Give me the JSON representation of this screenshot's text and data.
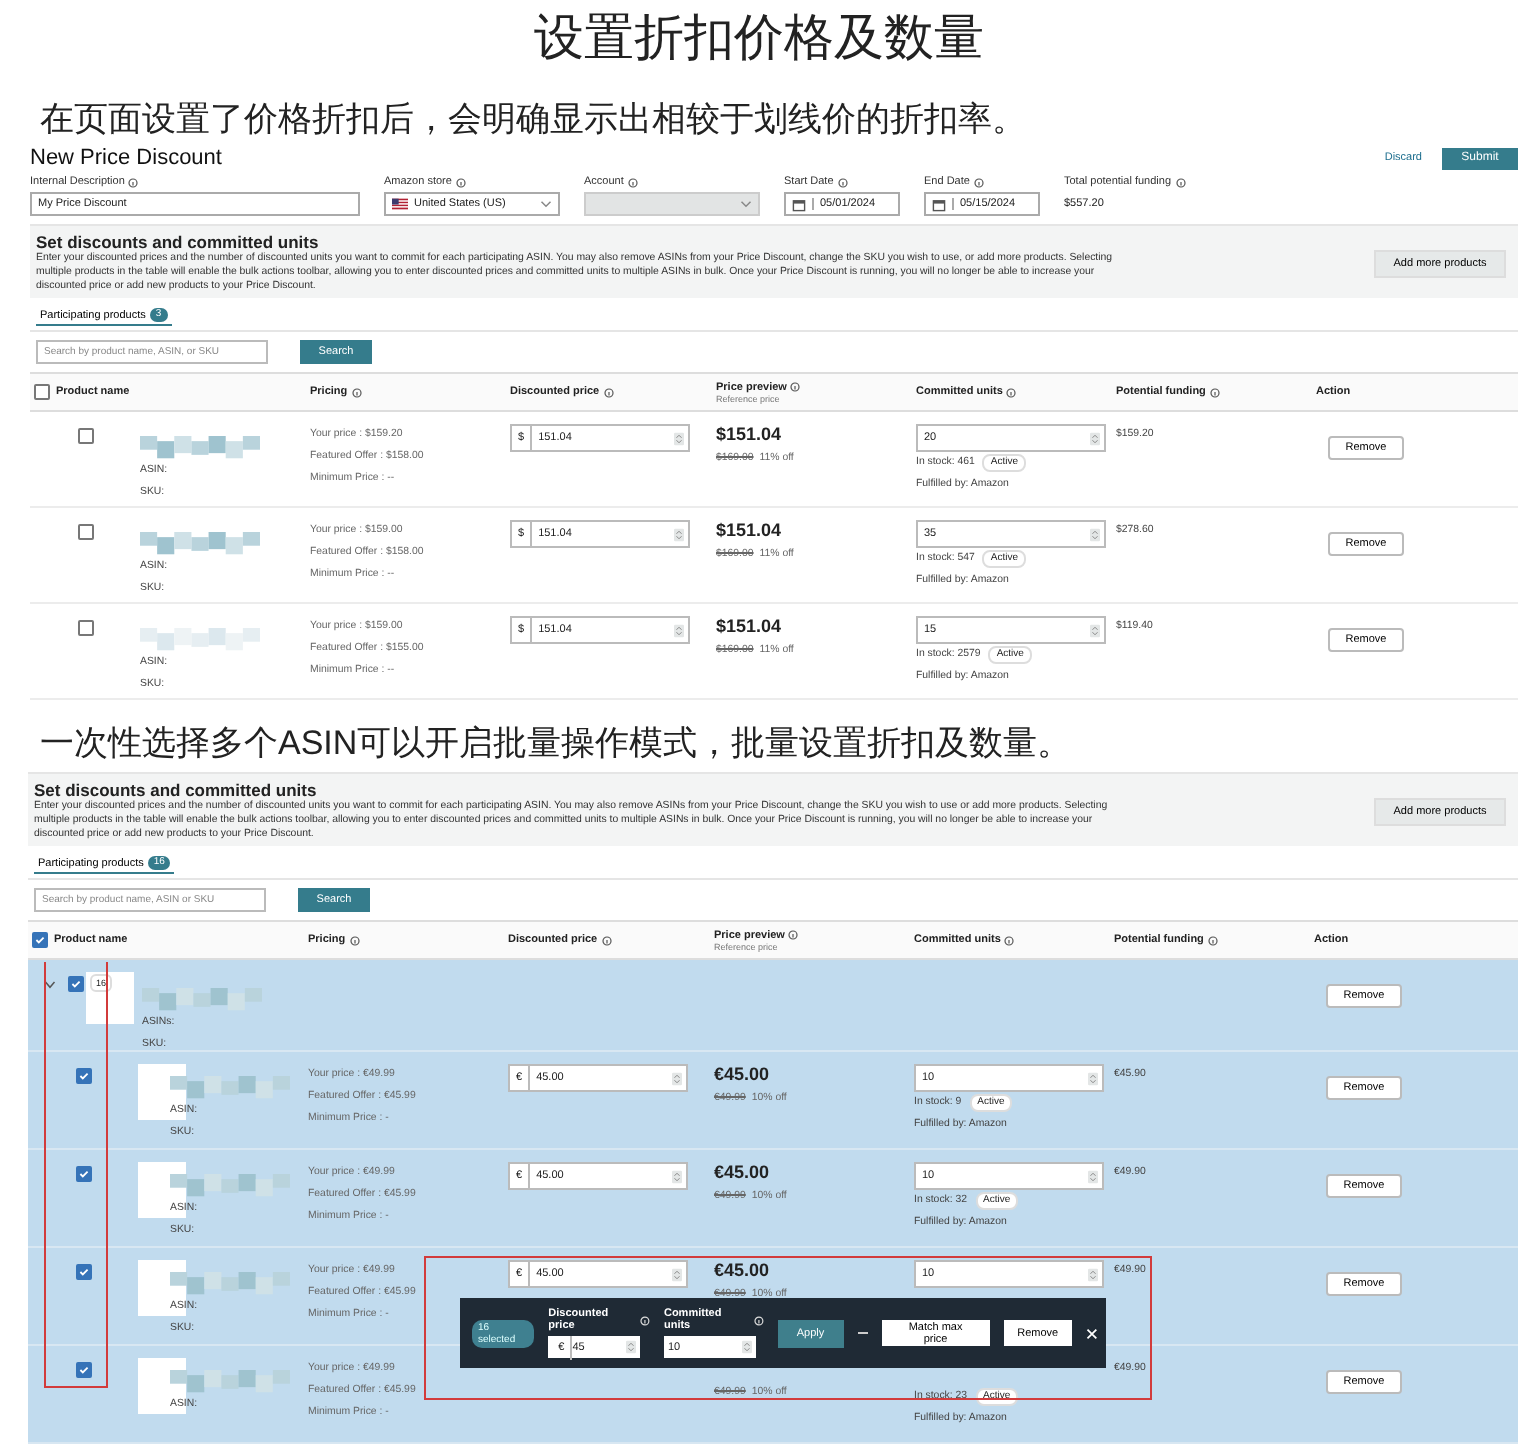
{
  "title": "设置折扣价格及数量",
  "sections": [
    {
      "caption": "在页面设置了价格折扣后，会明确显示出相较于划线价的折扣率。",
      "screen": {
        "form": {
          "title": "New Price Discount",
          "discard": "Discard",
          "submit": "Submit",
          "fields": [
            {
              "kind": "text",
              "label": "Internal Description",
              "value": "My Price Discount"
            },
            {
              "kind": "select",
              "label": "Amazon store",
              "value": "United States (US)"
            },
            {
              "kind": "select",
              "label": "Account",
              "disabled": true
            },
            {
              "kind": "date",
              "label": "Start Date",
              "value": "05/01/2024"
            },
            {
              "kind": "date",
              "label": "End Date",
              "value": "05/15/2024"
            },
            {
              "kind": "amount",
              "label": "Total potential funding",
              "value": "$557.20"
            }
          ]
        },
        "panel": {
          "heading": "Set discounts and committed units",
          "description": "Enter your discounted prices and the number of discounted units you want to commit for each participating ASIN. You may also remove ASINs from your Price Discount, change the SKU you wish to use, or add more products. Selecting multiple products in the table will enable the bulk actions toolbar, allowing you to enter discounted prices and committed units to multiple ASINs in bulk. Once your Price Discount is running, you will no longer be able to increase your discounted price or add new products to your Price Discount.",
          "add_button": "Add more products",
          "tab": "Participating products",
          "count": "3",
          "search_placeholder": "Search by product name, ASIN, or SKU",
          "search_button": "Search"
        },
        "table": {
          "all_checked": false,
          "columns": [
            "Product name",
            "Pricing",
            "Discounted price",
            "Price preview",
            "Committed units",
            "Potential funding",
            "Action"
          ],
          "preview_sub": "Reference price",
          "rows": [
            {
              "kind": "product",
              "selected": false,
              "checked": false,
              "asin_label": "ASIN:",
              "sku_label": "SKU:",
              "pricing": [
                "Your price : $159.20",
                "Featured Offer : $158.00",
                "Minimum Price : --"
              ],
              "currency": "$",
              "discounted_price": "151.04",
              "preview_price": "$151.04",
              "reference_price": "$169.00",
              "discount": "11% off",
              "committed_units": "20",
              "stock": "In stock: 461",
              "status": "Active",
              "fulfilled": "Fulfilled by: Amazon",
              "funding": "$159.20",
              "action": "Remove"
            },
            {
              "kind": "product",
              "selected": false,
              "checked": false,
              "asin_label": "ASIN:",
              "sku_label": "SKU:",
              "pricing": [
                "Your price : $159.00",
                "Featured Offer : $158.00",
                "Minimum Price : --"
              ],
              "currency": "$",
              "discounted_price": "151.04",
              "preview_price": "$151.04",
              "reference_price": "$169.00",
              "discount": "11% off",
              "committed_units": "35",
              "stock": "In stock: 547",
              "status": "Active",
              "fulfilled": "Fulfilled by: Amazon",
              "funding": "$278.60",
              "action": "Remove"
            },
            {
              "kind": "product",
              "selected": false,
              "checked": false,
              "asin_label": "ASIN:",
              "sku_label": "SKU:",
              "pricing": [
                "Your price : $159.00",
                "Featured Offer : $155.00",
                "Minimum Price : --"
              ],
              "currency": "$",
              "discounted_price": "151.04",
              "preview_price": "$151.04",
              "reference_price": "$169.00",
              "discount": "11% off",
              "committed_units": "15",
              "stock": "In stock: 2579",
              "status": "Active",
              "fulfilled": "Fulfilled by: Amazon",
              "funding": "$119.40",
              "action": "Remove"
            }
          ]
        }
      }
    },
    {
      "caption": "一次性选择多个ASIN可以开启批量操作模式，批量设置折扣及数量。",
      "screen": {
        "panel": {
          "heading": "Set discounts and committed units",
          "description": "Enter your discounted prices and the number of discounted units you want to commit for each participating ASIN. You may also remove ASINs from your Price Discount, change the SKU you wish to use or add more products. Selecting multiple products in the table will enable the bulk actions toolbar, allowing you to enter discounted prices and committed units to multiple ASINs in bulk. Once your Price Discount is running, you will no longer be able to increase your discounted price or add new products to your Price Discount.",
          "add_button": "Add more products",
          "tab": "Participating products",
          "count": "16",
          "search_placeholder": "Search by product name, ASIN or SKU",
          "search_button": "Search"
        },
        "table": {
          "all_checked": true,
          "checkbox_column_highlighted": true,
          "columns": [
            "Product name",
            "Pricing",
            "Discounted price",
            "Price preview",
            "Committed units",
            "Potential funding",
            "Action"
          ],
          "preview_sub": "Reference price",
          "rows": [
            {
              "kind": "group",
              "selected": true,
              "checked": true,
              "expanded": true,
              "count": "16",
              "asin_label": "ASINs:",
              "sku_label": "SKU:",
              "action": "Remove"
            },
            {
              "kind": "product",
              "selected": true,
              "checked": true,
              "asin_label": "ASIN:",
              "sku_label": "SKU:",
              "pricing": [
                "Your price : €49.99",
                "Featured Offer : €45.99",
                "Minimum Price : -"
              ],
              "currency": "€",
              "discounted_price": "45.00",
              "preview_price": "€45.00",
              "reference_price": "€49.99",
              "discount": "10% off",
              "committed_units": "10",
              "stock": "In stock: 9",
              "status": "Active",
              "fulfilled": "Fulfilled by: Amazon",
              "funding": "€45.90",
              "action": "Remove"
            },
            {
              "kind": "product",
              "selected": true,
              "checked": true,
              "asin_label": "ASIN:",
              "sku_label": "SKU:",
              "pricing": [
                "Your price : €49.99",
                "Featured Offer : €45.99",
                "Minimum Price : -"
              ],
              "currency": "€",
              "discounted_price": "45.00",
              "preview_price": "€45.00",
              "reference_price": "€49.99",
              "discount": "10% off",
              "committed_units": "10",
              "stock": "In stock: 32",
              "status": "Active",
              "fulfilled": "Fulfilled by: Amazon",
              "funding": "€49.90",
              "action": "Remove"
            },
            {
              "kind": "product",
              "selected": true,
              "checked": true,
              "asin_label": "ASIN:",
              "sku_label": "SKU:",
              "pricing": [
                "Your price : €49.99",
                "Featured Offer : €45.99",
                "Minimum Price : -"
              ],
              "currency": "€",
              "discounted_price": "45.00",
              "preview_price": "€45.00",
              "reference_price": "€49.99",
              "discount": "10% off",
              "committed_units": "10",
              "funding": "€49.90",
              "action": "Remove"
            },
            {
              "kind": "product",
              "selected": true,
              "checked": true,
              "asin_label": "ASIN:",
              "pricing": [
                "Your price : €49.99",
                "Featured Offer : €45.99",
                "Minimum Price : -"
              ],
              "reference_price": "€49.99",
              "discount": "10% off",
              "stock": "In stock: 23",
              "status": "Active",
              "fulfilled": "Fulfilled by: Amazon",
              "funding": "€49.90",
              "action": "Remove"
            }
          ]
        },
        "bulk_toolbar": {
          "selected_count": "16 selected",
          "price_label": "Discounted price",
          "currency": "€",
          "price_value": "45",
          "units_label": "Committed units",
          "units_value": "10",
          "apply": "Apply",
          "match": "Match max price",
          "remove": "Remove",
          "highlighted": true
        }
      }
    }
  ]
}
